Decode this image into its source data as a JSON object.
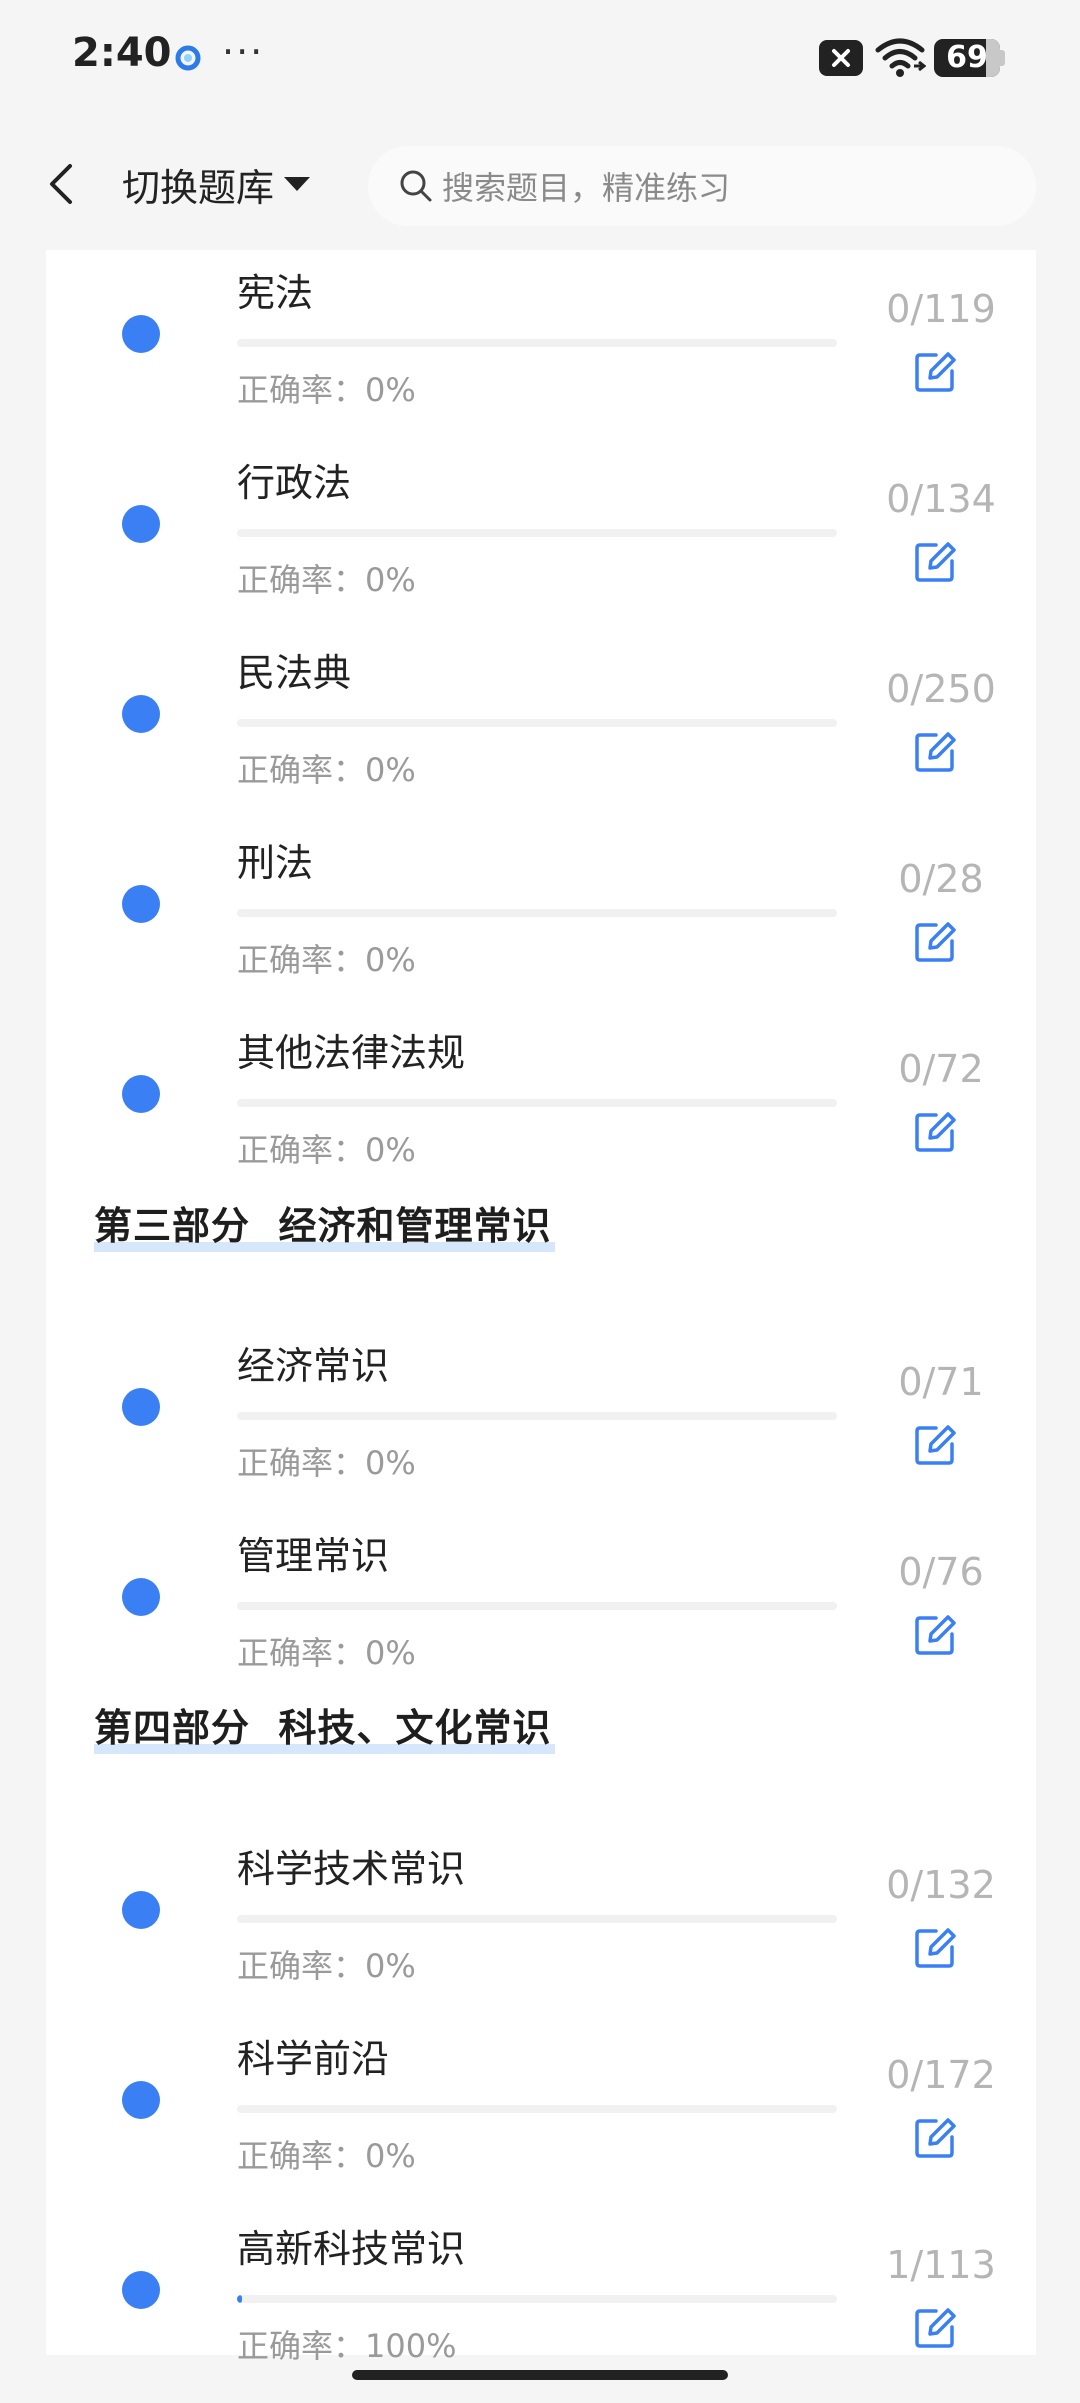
{
  "status_bar": {
    "time": "2:40",
    "more": "···",
    "battery": "69",
    "icons": [
      "app-icon",
      "close-icon",
      "wifi-icon",
      "battery-icon"
    ]
  },
  "header": {
    "back_icon": "chevron-left-icon",
    "bank_switch_label": "切换题库",
    "search_placeholder": "搜索题目，精准练习"
  },
  "colors": {
    "accent": "#3a80f4",
    "count_gray": "#b5b5b5",
    "section_highlight": "#d6e6fb"
  },
  "groups": [
    {
      "section_title": "",
      "items": [
        {
          "title": "宪法",
          "accuracy": "正确率：0%",
          "count": "0/119",
          "progress": 0
        },
        {
          "title": "行政法",
          "accuracy": "正确率：0%",
          "count": "0/134",
          "progress": 0
        },
        {
          "title": "民法典",
          "accuracy": "正确率：0%",
          "count": "0/250",
          "progress": 0
        },
        {
          "title": "刑法",
          "accuracy": "正确率：0%",
          "count": "0/28",
          "progress": 0
        },
        {
          "title": "其他法律法规",
          "accuracy": "正确率：0%",
          "count": "0/72",
          "progress": 0
        }
      ]
    },
    {
      "section_title": "第三部分  经济和管理常识",
      "items": [
        {
          "title": "经济常识",
          "accuracy": "正确率：0%",
          "count": "0/71",
          "progress": 0
        },
        {
          "title": "管理常识",
          "accuracy": "正确率：0%",
          "count": "0/76",
          "progress": 0
        }
      ]
    },
    {
      "section_title": "第四部分  科技、文化常识",
      "items": [
        {
          "title": "科学技术常识",
          "accuracy": "正确率：0%",
          "count": "0/132",
          "progress": 0
        },
        {
          "title": "科学前沿",
          "accuracy": "正确率：0%",
          "count": "0/172",
          "progress": 0
        },
        {
          "title": "高新科技常识",
          "accuracy": "正确率：100%",
          "count": "1/113",
          "progress": 0.0088
        }
      ]
    }
  ]
}
